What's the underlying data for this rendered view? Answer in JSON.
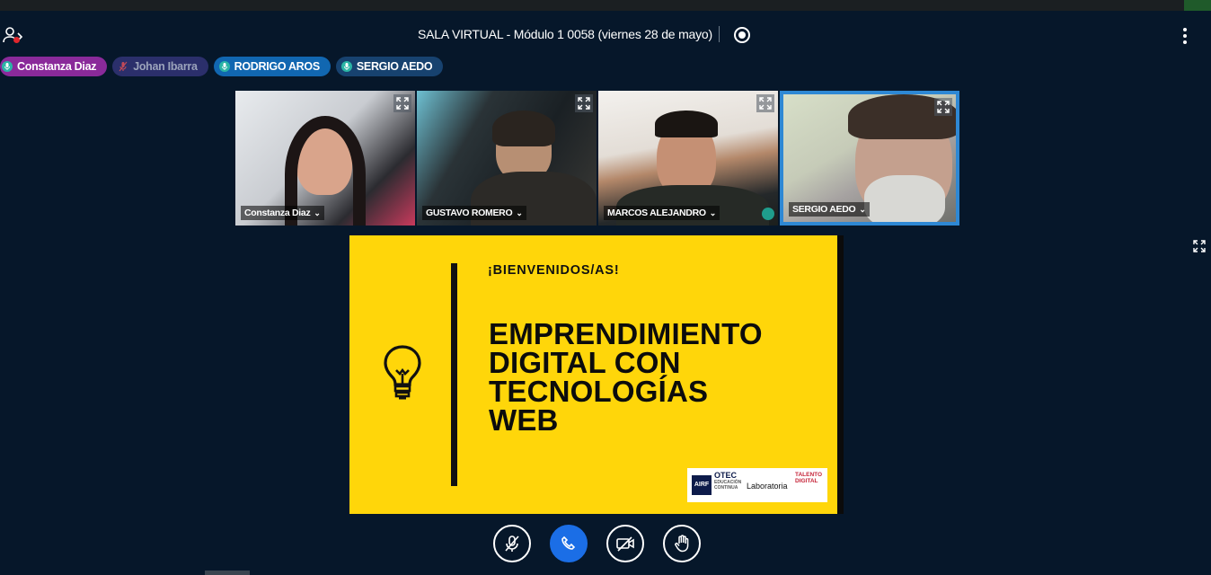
{
  "header": {
    "title": "SALA VIRTUAL - Módulo 1 0058 (viernes 28 de mayo)",
    "users_icon": "users-toggle-icon",
    "record_icon": "record-icon",
    "more_icon": "more-options-icon"
  },
  "participants": [
    {
      "name": "Constanza Diaz",
      "muted": false,
      "color": "#8a2a9a"
    },
    {
      "name": "Johan Ibarra",
      "muted": true,
      "color": "#2b2f6b"
    },
    {
      "name": "RODRIGO AROS",
      "muted": false,
      "color": "#1167b1"
    },
    {
      "name": "SERGIO AEDO",
      "muted": false,
      "color": "#17426f"
    }
  ],
  "videos": [
    {
      "name": "Constanza Diaz"
    },
    {
      "name": "GUSTAVO ROMERO"
    },
    {
      "name": "MARCOS ALEJANDRO"
    },
    {
      "name": "SERGIO AEDO"
    }
  ],
  "presentation": {
    "welcome": "¡BIENVENIDOS/AS!",
    "course_lines": [
      "EMPRENDIMIENTO",
      "DIGITAL CON",
      "TECNOLOGÍAS",
      "WEB"
    ],
    "logos": {
      "airf": "AIRF",
      "otec": "OTEC",
      "otec_sub1": "EDUCACIÓN",
      "otec_sub2": "CONTINUA",
      "laboratoria": "Laboratoria",
      "talento1": "TALENTO",
      "talento2": "DIGITAL"
    },
    "background_color": "#ffd60a"
  },
  "controls": {
    "mic": "mic-muted-icon",
    "leave": "phone-icon",
    "camera": "camera-off-icon",
    "hand": "raise-hand-icon"
  }
}
